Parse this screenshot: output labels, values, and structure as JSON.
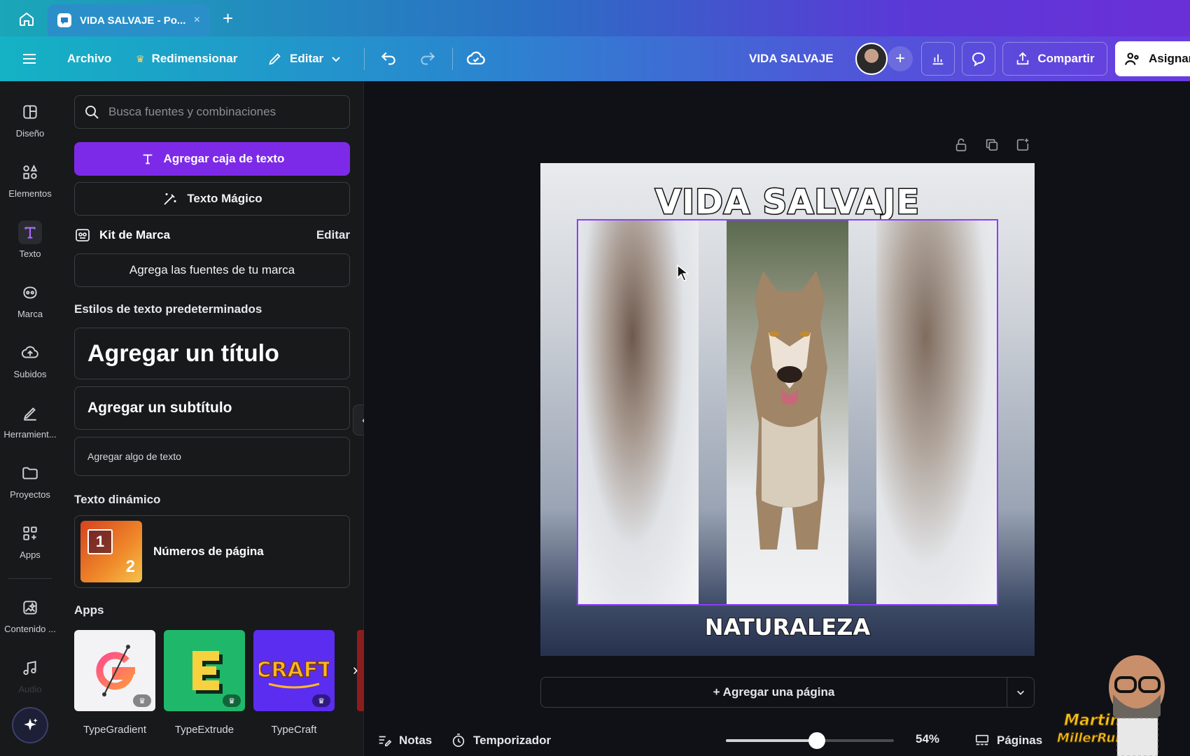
{
  "browser": {
    "tab_title": "VIDA SALVAJE - Po...",
    "tab_close": "×",
    "new_tab": "+"
  },
  "toolbar": {
    "file": "Archivo",
    "resize": "Redimensionar",
    "edit": "Editar",
    "doc_title": "VIDA SALVAJE",
    "share": "Compartir",
    "assign": "Asignar",
    "add_collaborator": "+"
  },
  "rail": [
    {
      "label": "Diseño",
      "icon": "layout-icon"
    },
    {
      "label": "Elementos",
      "icon": "shapes-icon"
    },
    {
      "label": "Texto",
      "icon": "text-icon"
    },
    {
      "label": "Marca",
      "icon": "brand-icon"
    },
    {
      "label": "Subidos",
      "icon": "upload-icon"
    },
    {
      "label": "Herramient...",
      "icon": "pen-icon"
    },
    {
      "label": "Proyectos",
      "icon": "folder-icon"
    },
    {
      "label": "Apps",
      "icon": "apps-icon"
    },
    {
      "label": "Contenido ...",
      "icon": "magic-media-icon"
    },
    {
      "label": "Audio",
      "icon": "music-icon"
    }
  ],
  "panel": {
    "search_placeholder": "Busca fuentes y combinaciones",
    "add_textbox": "Agregar caja de texto",
    "magic_text": "Texto Mágico",
    "brand_kit": "Kit de Marca",
    "brand_kit_edit": "Editar",
    "add_brand_fonts": "Agrega las fuentes de tu marca",
    "default_styles_title": "Estilos de texto predeterminados",
    "add_heading": "Agregar un título",
    "add_subheading": "Agregar un subtítulo",
    "add_body": "Agregar algo de texto",
    "dynamic_title": "Texto dinámico",
    "page_numbers": "Números de página",
    "dynamic_thumb_1": "1",
    "dynamic_thumb_2": "2",
    "apps_title": "Apps",
    "apps": [
      {
        "name": "TypeGradient"
      },
      {
        "name": "TypeExtrude"
      },
      {
        "name": "TypeCraft"
      }
    ]
  },
  "design": {
    "title": "VIDA SALVAJE",
    "subtitle": "NATURALEZA"
  },
  "canvas": {
    "add_page": "+ Agregar una página"
  },
  "bottom": {
    "notes": "Notas",
    "timer": "Temporizador",
    "zoom": "54%",
    "zoom_fraction": 0.54,
    "pages": "Páginas"
  },
  "watermark": {
    "text_line1": "Martin",
    "text_line2": "Miller Ruiz"
  },
  "colors": {
    "accent": "#7d2ae8",
    "selection": "#8b3dff"
  }
}
